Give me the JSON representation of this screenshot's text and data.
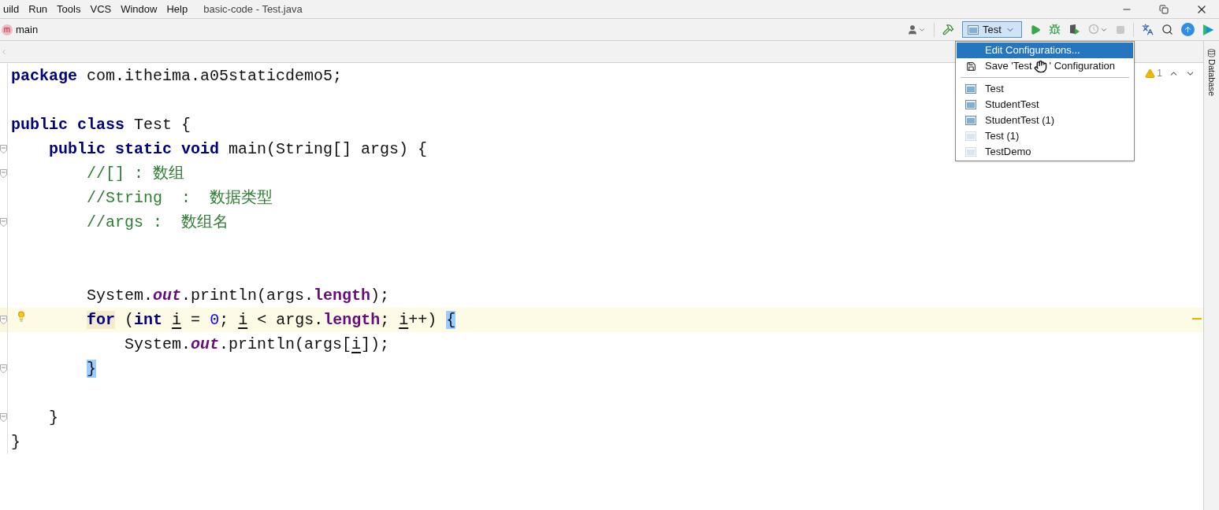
{
  "menu_bar": [
    "uild",
    "Run",
    "Tools",
    "VCS",
    "Window",
    "Help"
  ],
  "window": {
    "title": "basic-code - Test.java"
  },
  "nav_bar": {
    "icon_letter": "m",
    "method": "main"
  },
  "run_config": {
    "label": "Test",
    "expanded": true
  },
  "config_menu": {
    "actions": [
      {
        "label": "Edit Configurations...",
        "selected": true,
        "kind": "plain"
      },
      {
        "label": "Save 'Test",
        "label_tail": "' Configuration",
        "selected": false,
        "kind": "save"
      }
    ],
    "configs": [
      {
        "label": "Test",
        "faded": false
      },
      {
        "label": "StudentTest",
        "faded": false
      },
      {
        "label": "StudentTest (1)",
        "faded": false
      },
      {
        "label": "Test (1)",
        "faded": true
      },
      {
        "label": "TestDemo",
        "faded": true
      }
    ]
  },
  "inspections": {
    "warnings": "1"
  },
  "side_tab": "Database",
  "code": [
    {
      "fold": false,
      "current": false,
      "tokens": [
        {
          "kind": "kw",
          "text": "package"
        },
        {
          "kind": "plain",
          "text": " com.itheima.a05staticdemo5;"
        }
      ]
    },
    {
      "fold": false,
      "current": false
    },
    {
      "fold": false,
      "current": false,
      "tokens": [
        {
          "kind": "kw",
          "text": "public class"
        },
        {
          "kind": "plain",
          "text": " Test {"
        }
      ]
    },
    {
      "fold": true,
      "current": false,
      "tokens": [
        {
          "kind": "kw",
          "text": "    public static void"
        },
        {
          "kind": "plain",
          "text": " main(String[] args) {"
        }
      ]
    },
    {
      "fold": true,
      "current": false,
      "tokens": [
        {
          "kind": "comment",
          "text": "        //[] : 数组"
        }
      ]
    },
    {
      "fold": false,
      "current": false,
      "tokens": [
        {
          "kind": "comment",
          "text": "        //String  :  数据类型"
        }
      ]
    },
    {
      "fold": true,
      "current": false,
      "tokens": [
        {
          "kind": "comment",
          "text": "        //args :  数组名"
        }
      ]
    },
    {
      "fold": false,
      "current": false
    },
    {
      "fold": false,
      "current": false
    },
    {
      "fold": false,
      "current": false,
      "tokens": [
        {
          "kind": "plain",
          "text": "        System."
        },
        {
          "kind": "field",
          "text": "out"
        },
        {
          "kind": "plain",
          "text": ".println(args."
        },
        {
          "kind": "member",
          "text": "length"
        },
        {
          "kind": "plain",
          "text": ");"
        }
      ]
    },
    {
      "fold": true,
      "current": true,
      "tokens": [
        {
          "kind": "kw-hl",
          "text": "        for"
        },
        {
          "kind": "plain",
          "text": " ("
        },
        {
          "kind": "kw",
          "text": "int "
        },
        {
          "kind": "var",
          "text": "i"
        },
        {
          "kind": "plain",
          "text": " = "
        },
        {
          "kind": "num",
          "text": "0"
        },
        {
          "kind": "plain",
          "text": "; "
        },
        {
          "kind": "var",
          "text": "i"
        },
        {
          "kind": "plain",
          "text": " < args."
        },
        {
          "kind": "member",
          "text": "length"
        },
        {
          "kind": "plain",
          "text": "; "
        },
        {
          "kind": "var",
          "text": "i"
        },
        {
          "kind": "plain",
          "text": "++) "
        },
        {
          "kind": "match",
          "text": "{"
        }
      ]
    },
    {
      "fold": false,
      "current": false,
      "tokens": [
        {
          "kind": "plain",
          "text": "            System."
        },
        {
          "kind": "field",
          "text": "out"
        },
        {
          "kind": "plain",
          "text": ".println(args["
        },
        {
          "kind": "var",
          "text": "i"
        },
        {
          "kind": "plain",
          "text": "]);"
        }
      ]
    },
    {
      "fold": true,
      "current": false,
      "tokens": [
        {
          "kind": "match",
          "text": "        }"
        }
      ]
    },
    {
      "fold": false,
      "current": false
    },
    {
      "fold": true,
      "current": false,
      "tokens": [
        {
          "kind": "plain",
          "text": "    }"
        }
      ]
    },
    {
      "fold": false,
      "current": false,
      "tokens": [
        {
          "kind": "plain",
          "text": "}"
        }
      ]
    }
  ]
}
